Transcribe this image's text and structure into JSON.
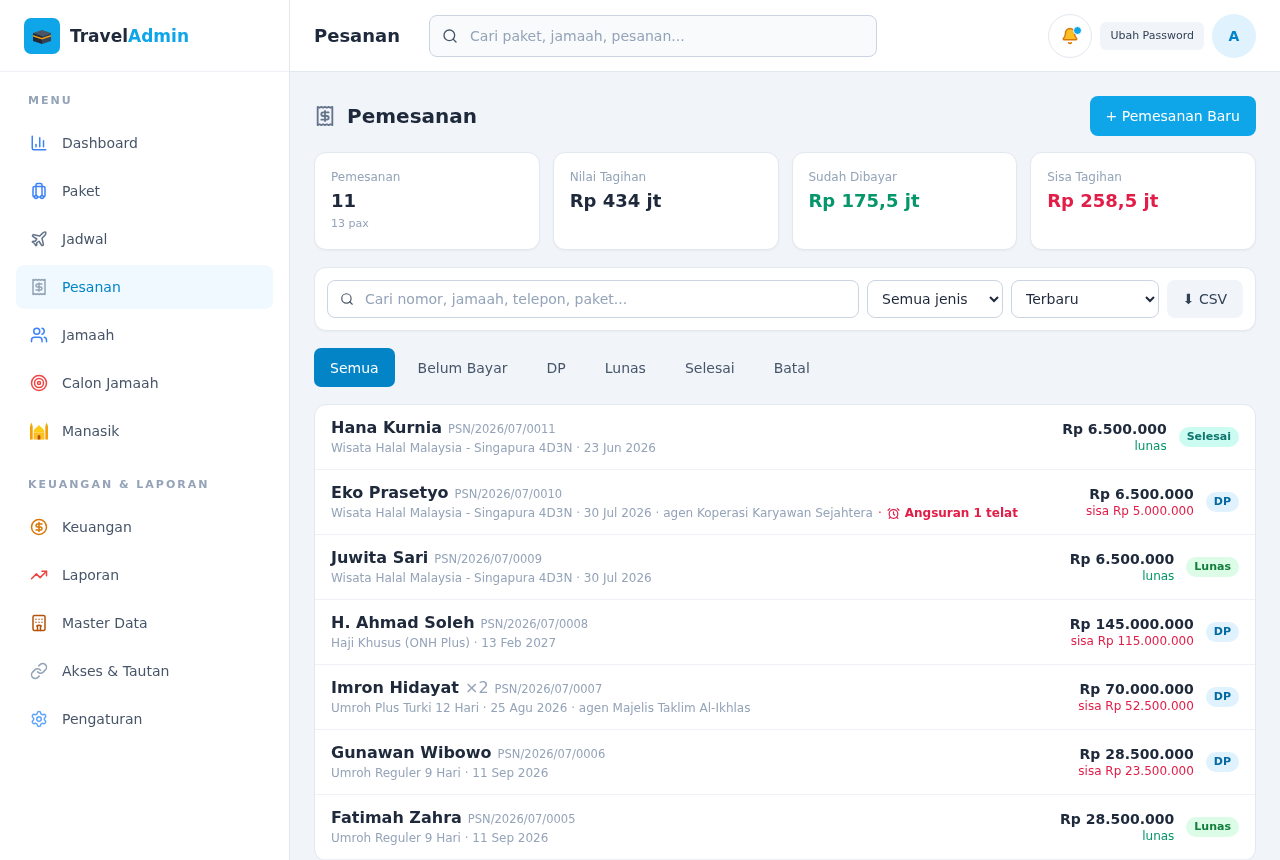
{
  "sidebar": {
    "brand": {
      "name_start": "Travel",
      "name_accent": "Admin"
    },
    "sections": [
      {
        "title": "MENU",
        "items": [
          {
            "label": "Dashboard",
            "selected": false
          },
          {
            "label": "Paket",
            "selected": false
          },
          {
            "label": "Jadwal",
            "selected": false
          },
          {
            "label": "Pesanan",
            "selected": true
          },
          {
            "label": "Jamaah",
            "selected": false
          },
          {
            "label": "Calon Jamaah",
            "selected": false
          },
          {
            "label": "Manasik",
            "selected": false
          }
        ]
      },
      {
        "title": "KEUANGAN & LAPORAN",
        "items": [
          {
            "label": "Keuangan",
            "selected": false
          },
          {
            "label": "Laporan",
            "selected": false
          },
          {
            "label": "Master Data",
            "selected": false
          },
          {
            "label": "Akses & Tautan",
            "selected": false
          },
          {
            "label": "Pengaturan",
            "selected": false
          }
        ]
      }
    ]
  },
  "header": {
    "title": "Pesanan",
    "search": {
      "placeholder": "Cari paket, jamaah, pesanan..."
    },
    "notifications": {
      "unread": true
    },
    "password_button": "Ubah Password",
    "avatar": "A"
  },
  "page": {
    "title": "Pemesanan",
    "new_button": "+ Pemesanan Baru"
  },
  "stats": [
    {
      "label": "Pemesanan",
      "value": "11",
      "note": "13 pax",
      "color": "#1e293b"
    },
    {
      "label": "Nilai Tagihan",
      "value": "Rp 434 jt",
      "color": "#1e293b"
    },
    {
      "label": "Sudah Dibayar",
      "value": "Rp 175,5 jt",
      "color": "#059669"
    },
    {
      "label": "Sisa Tagihan",
      "value": "Rp 258,5 jt",
      "color": "#e11d48"
    }
  ],
  "filters": {
    "search": {
      "placeholder": "Cari nomor, jamaah, telepon, paket..."
    },
    "type_select": "Semua jenis",
    "sort_select": "Terbaru",
    "export_button": "⬇ CSV"
  },
  "tabs": [
    {
      "label": "Semua",
      "selected": true
    },
    {
      "label": "Belum Bayar",
      "selected": false
    },
    {
      "label": "DP",
      "selected": false
    },
    {
      "label": "Lunas",
      "selected": false
    },
    {
      "label": "Selesai",
      "selected": false
    },
    {
      "label": "Batal",
      "selected": false
    }
  ],
  "orders": [
    {
      "name": "Hana Kurnia",
      "number": "PSN/2026/07/0011",
      "details": "Wisata Halal Malaysia - Singapura 4D3N · 23 Jun 2026",
      "amount": "Rp 6.500.000",
      "balance": {
        "kind": "paid",
        "text": "lunas"
      },
      "badge": {
        "kind": "selesai",
        "label": "Selesai"
      }
    },
    {
      "name": "Eko Prasetyo",
      "number": "PSN/2026/07/0010",
      "details": "Wisata Halal Malaysia - Singapura 4D3N · 30 Jul 2026 · agen Koperasi Karyawan Sejahtera",
      "alert": {
        "separator": "·",
        "text": "Angsuran 1 telat"
      },
      "amount": "Rp 6.500.000",
      "balance": {
        "kind": "due",
        "text": "sisa Rp 5.000.000"
      },
      "badge": {
        "kind": "dp",
        "label": "DP"
      }
    },
    {
      "name": "Juwita Sari",
      "number": "PSN/2026/07/0009",
      "details": "Wisata Halal Malaysia - Singapura 4D3N · 30 Jul 2026",
      "amount": "Rp 6.500.000",
      "balance": {
        "kind": "paid",
        "text": "lunas"
      },
      "badge": {
        "kind": "lunas",
        "label": "Lunas"
      }
    },
    {
      "name": "H. Ahmad Soleh",
      "number": "PSN/2026/07/0008",
      "details": "Haji Khusus (ONH Plus) · 13 Feb 2027",
      "amount": "Rp 145.000.000",
      "balance": {
        "kind": "due",
        "text": "sisa Rp 115.000.000"
      },
      "badge": {
        "kind": "dp",
        "label": "DP"
      }
    },
    {
      "name": "Imron Hidayat",
      "pax": "×2",
      "number": "PSN/2026/07/0007",
      "details": "Umroh Plus Turki 12 Hari · 25 Agu 2026 · agen Majelis Taklim Al-Ikhlas",
      "amount": "Rp 70.000.000",
      "balance": {
        "kind": "due",
        "text": "sisa Rp 52.500.000"
      },
      "badge": {
        "kind": "dp",
        "label": "DP"
      }
    },
    {
      "name": "Gunawan Wibowo",
      "number": "PSN/2026/07/0006",
      "details": "Umroh Reguler 9 Hari · 11 Sep 2026",
      "amount": "Rp 28.500.000",
      "balance": {
        "kind": "due",
        "text": "sisa Rp 23.500.000"
      },
      "badge": {
        "kind": "dp",
        "label": "DP"
      }
    },
    {
      "name": "Fatimah Zahra",
      "number": "PSN/2026/07/0005",
      "details": "Umroh Reguler 9 Hari · 11 Sep 2026",
      "amount": "Rp 28.500.000",
      "balance": {
        "kind": "paid",
        "text": "lunas"
      },
      "badge": {
        "kind": "lunas",
        "label": "Lunas"
      }
    }
  ]
}
